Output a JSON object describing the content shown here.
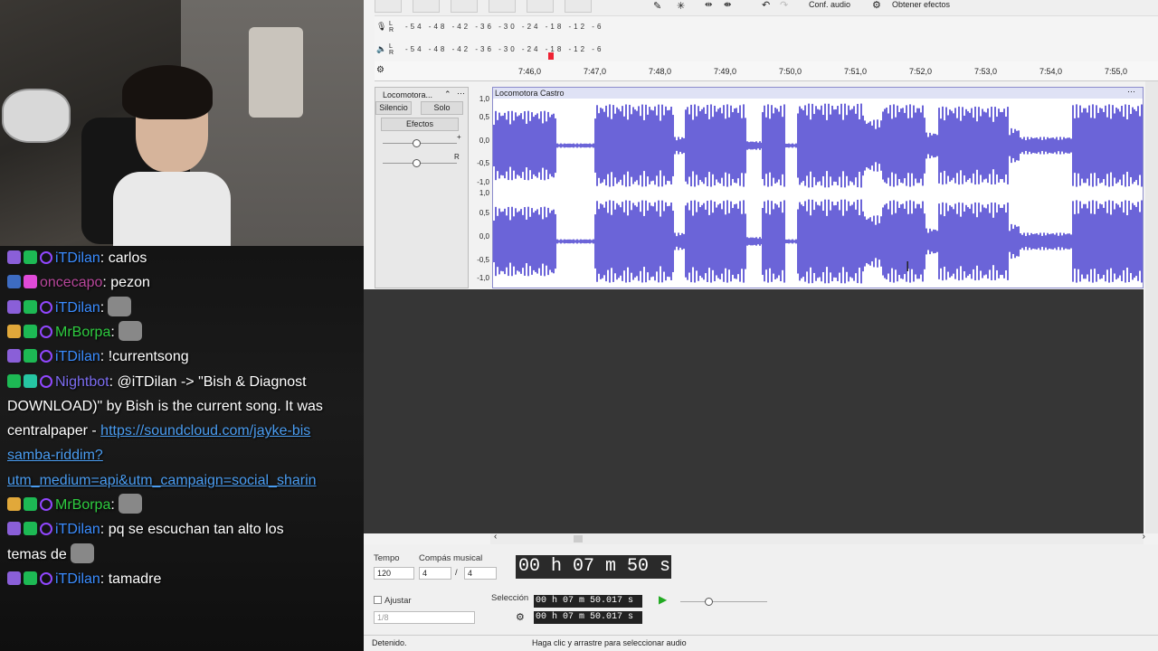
{
  "toolbar": {
    "audio_setup_label": "Conf. audio",
    "get_effects_label": "Obtener efectos"
  },
  "meters": {
    "rec_scale": "-54 -48 -42 -36 -30 -24 -18 -12 -6",
    "play_scale": "-54 -48 -42 -36 -30 -24 -18 -12 -6",
    "rec_lr": "L R",
    "play_lr": "L R"
  },
  "ruler": {
    "ticks": [
      "7:46,0",
      "7:47,0",
      "7:48,0",
      "7:49,0",
      "7:50,0",
      "7:51,0",
      "7:52,0",
      "7:53,0",
      "7:54,0",
      "7:55,0"
    ]
  },
  "track": {
    "name": "Locomotora...",
    "clip_name": "Locomotora Castro",
    "mute_label": "Silencio",
    "solo_label": "Solo",
    "effects_label": "Efectos",
    "pan_r": "R",
    "gain_plus": "+"
  },
  "scale": {
    "labels": [
      "1,0",
      "0,5",
      "0,0",
      "-0,5",
      "-1,0",
      "1,0",
      "0,5",
      "0,0",
      "-0,5",
      "-1,0"
    ]
  },
  "bottom": {
    "tempo_label": "Tempo",
    "tempo_value": "120",
    "meter_label": "Compás musical",
    "meter_num": "4",
    "meter_sep": "/",
    "meter_den": "4",
    "time_display": "00 h 07 m 50 s",
    "snap_label": "Ajustar",
    "snap_value": "1/8",
    "selection_label": "Selección",
    "sel_start": "00 h 07 m 50.017 s",
    "sel_end": "00 h 07 m 50.017 s"
  },
  "status": {
    "left": "Detenido.",
    "right": "Haga clic y arrastre para seleccionar audio"
  },
  "chat": [
    {
      "badges": [
        "b-sub",
        "b-mod",
        "b-prime"
      ],
      "user": "iTDilan",
      "color": "#3a8cff",
      "text": ": carlos"
    },
    {
      "badges": [
        "b-a",
        "b-heart"
      ],
      "user": "oncecapo",
      "color": "#b7469a",
      "text": ": pezon"
    },
    {
      "badges": [
        "b-sub",
        "b-mod",
        "b-prime"
      ],
      "user": "iTDilan",
      "color": "#3a8cff",
      "text": ":",
      "emote": true
    },
    {
      "badges": [
        "b-cake",
        "b-mod",
        "b-prime"
      ],
      "user": "MrBorpa",
      "color": "#2ecc40",
      "text": ":",
      "emote": true
    },
    {
      "badges": [
        "b-sub",
        "b-mod",
        "b-prime"
      ],
      "user": "iTDilan",
      "color": "#3a8cff",
      "text": ": !currentsong"
    },
    {
      "badges": [
        "b-mod",
        "b-bot",
        "b-prime"
      ],
      "user": "Nightbot",
      "color": "#7b6cf0",
      "text": ": @iTDilan -> \"Bish & Diagnost"
    },
    {
      "line": "DOWNLOAD)\" by Bish is the current song. It was"
    },
    {
      "line_pre": "centralpaper - ",
      "link": "https://soundcloud.com/jayke-bis"
    },
    {
      "link": "samba-riddim?"
    },
    {
      "link": "utm_medium=api&utm_campaign=social_sharin"
    },
    {
      "badges": [
        "b-cake",
        "b-mod",
        "b-prime"
      ],
      "user": "MrBorpa",
      "color": "#2ecc40",
      "text": ":",
      "emote": true
    },
    {
      "badges": [
        "b-sub",
        "b-mod",
        "b-prime"
      ],
      "user": "iTDilan",
      "color": "#3a8cff",
      "text": ": pq se escuchan tan alto los"
    },
    {
      "line": "temas de",
      "emote": true
    },
    {
      "badges": [
        "b-sub",
        "b-mod",
        "b-prime"
      ],
      "user": "iTDilan",
      "color": "#3a8cff",
      "text": ": tamadre"
    }
  ]
}
